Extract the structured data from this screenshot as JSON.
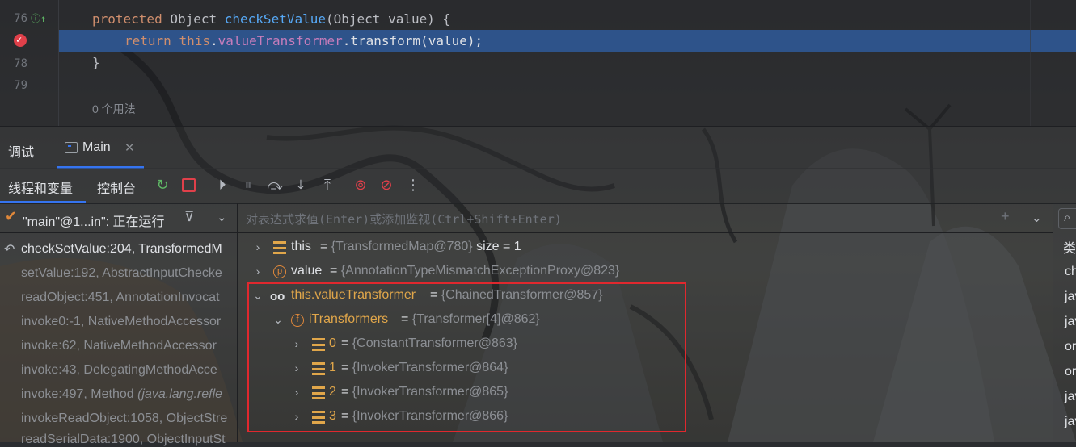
{
  "editor": {
    "lines": [
      {
        "num": "76",
        "has_override_marker": true
      },
      {
        "num": "",
        "has_breakpoint": true
      },
      {
        "num": "78"
      },
      {
        "num": "79"
      }
    ],
    "code": {
      "line1_kw1": "protected",
      "line1_type": " Object ",
      "line1_fn": "checkSetValue",
      "line1_rest": "(Object value) {",
      "line2_kw": "return",
      "line2_this": "this",
      "line2_field": "valueTransformer",
      "line2_rest": ".transform(value);",
      "line3": "}"
    },
    "usages_hint": "0 个用法"
  },
  "toolwindow": {
    "title": "调试",
    "tab_label": "Main"
  },
  "debugger": {
    "tabs": [
      "线程和变量",
      "控制台"
    ],
    "thread": "\"main\"@1...in\": 正在运行",
    "frames": [
      {
        "method": "checkSetValue:204, TransformedM",
        "selected": true
      },
      {
        "method": "setValue:192, AbstractInputChecke"
      },
      {
        "method": "readObject:451, AnnotationInvocat"
      },
      {
        "method": "invoke0:-1, NativeMethodAccessor"
      },
      {
        "method": "invoke:62, NativeMethodAccessor"
      },
      {
        "method": "invoke:43, DelegatingMethodAcce"
      },
      {
        "method": "invoke:497, Method ",
        "italic": "(java.lang.refle"
      },
      {
        "method": "invokeReadObject:1058, ObjectStre"
      },
      {
        "method": "readSerialData:1900, ObjectInputSt"
      }
    ],
    "watch_placeholder": "对表达式求值(Enter)或添加监视(Ctrl+Shift+Enter)",
    "variables": [
      {
        "name": "this",
        "value": "{TransformedMap@780}",
        "extra": "size = 1"
      },
      {
        "name": "value",
        "value": "{AnnotationTypeMismatchExceptionProxy@823}"
      },
      {
        "name": "this.valueTransformer",
        "value": "{ChainedTransformer@857}"
      },
      {
        "name": "iTransformers",
        "value": "{Transformer[4]@862}"
      },
      {
        "name": "0",
        "value": "{ConstantTransformer@863}"
      },
      {
        "name": "1",
        "value": "{InvokerTransformer@864}"
      },
      {
        "name": "2",
        "value": "{InvokerTransformer@865}"
      },
      {
        "name": "3",
        "value": "{InvokerTransformer@866}"
      }
    ],
    "icon_letters": {
      "value": "p",
      "field": "f"
    },
    "equals": "="
  },
  "right_panel": {
    "header": "类",
    "items": [
      "ch",
      "jav",
      "jav",
      "or",
      "or",
      "jav",
      "jav"
    ]
  },
  "colors": {
    "accent": "#3574f0",
    "highlight_line": "#2f5a9a",
    "keyword": "#cf8e6d",
    "function": "#56a8f5",
    "field": "#c77dbb",
    "variable_name": "#e0a64a",
    "annotation_box": "#e0282e",
    "breakpoint": "#e0404a"
  }
}
